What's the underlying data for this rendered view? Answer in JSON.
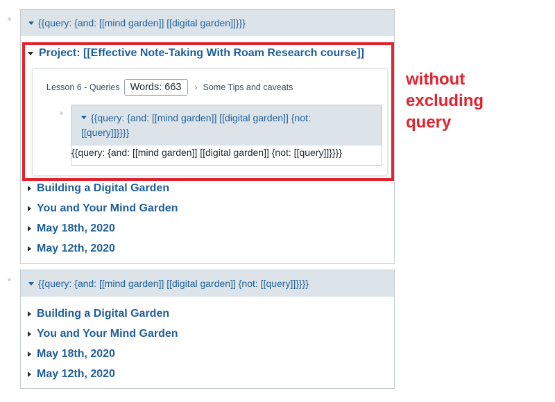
{
  "colors": {
    "link_blue": "#1f5f99",
    "query_header_bg": "#dce4ea",
    "annotation_red": "#e0232e",
    "text_dark": "#202b33"
  },
  "query1": {
    "header": "{{query:  {and: [[mind garden]] [[digital garden]]}}}",
    "expanded_result": {
      "title": "Project: [[Effective Note-Taking With Roam Research course]]",
      "breadcrumb": {
        "lesson": "Lesson 6 - Queries",
        "wordcount": "Words: 663",
        "separator_icon": "chevron-right-icon",
        "child": "Some Tips and caveats"
      },
      "nested_query": {
        "header_line1": "{{query:  {and: [[mind garden]] [[digital garden]] {not:",
        "header_line2": "[[query]]}}}}",
        "raw_text": "{{query:  {and: [[mind garden]] [[digital garden]] {not: [[query]]}}}}"
      }
    },
    "collapsed_results": [
      "Building a Digital Garden",
      "You and Your Mind Garden",
      "May 18th, 2020",
      "May 12th, 2020"
    ]
  },
  "query2": {
    "header": "{{query:  {and: [[mind garden]] [[digital garden]] {not: [[query]]}}}}",
    "collapsed_results": [
      "Building a Digital Garden",
      "You and Your Mind Garden",
      "May 18th, 2020",
      "May 12th, 2020"
    ]
  },
  "annotation": {
    "line1": "without",
    "line2": "excluding",
    "line3": "query"
  }
}
